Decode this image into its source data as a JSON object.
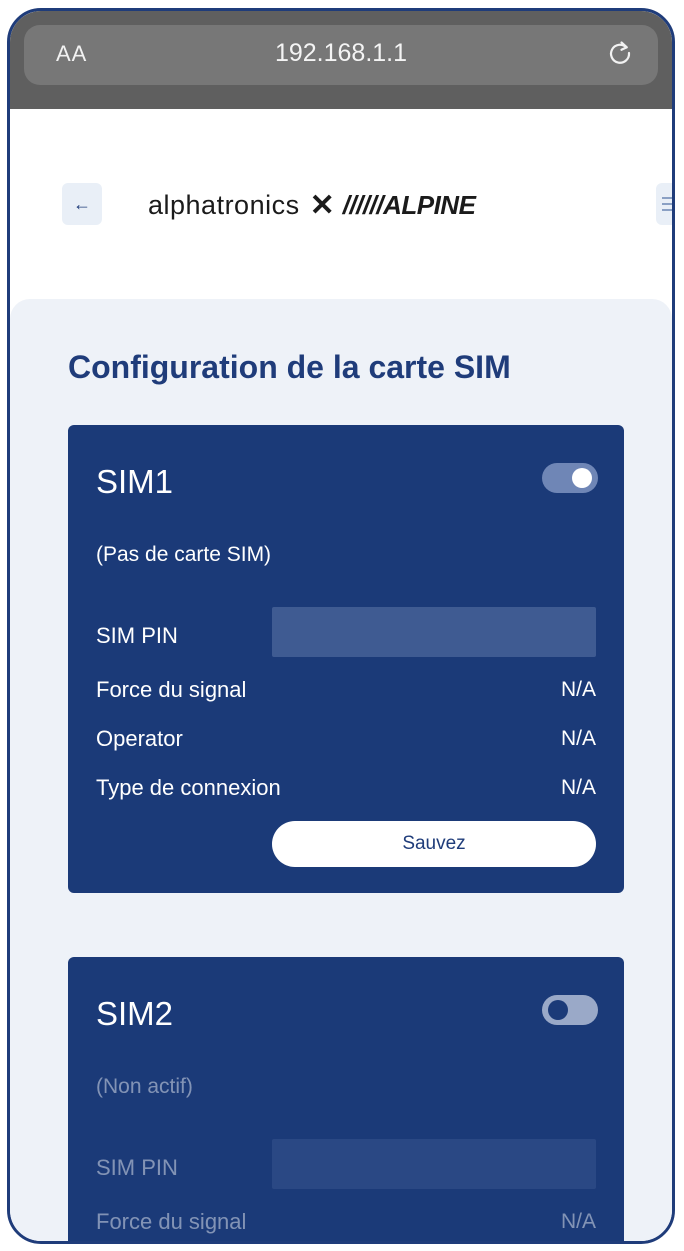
{
  "browser": {
    "text_size_label": "AA",
    "url": "192.168.1.1",
    "reload_icon": "reload-icon"
  },
  "header": {
    "back_icon": "←",
    "logo_left": "alphatronics",
    "logo_x": "✕",
    "logo_right": "//////ALPINE",
    "menu_icon": "hamburger-menu-icon"
  },
  "page": {
    "title": "Configuration de la carte SIM"
  },
  "sim1": {
    "title": "SIM1",
    "enabled": true,
    "status": "(Pas de carte SIM)",
    "pin_label": "SIM PIN",
    "pin_value": "",
    "signal_label": "Force du signal",
    "signal_value": "N/A",
    "operator_label": "Operator",
    "operator_value": "N/A",
    "connection_label": "Type de connexion",
    "connection_value": "N/A",
    "save_label": "Sauvez"
  },
  "sim2": {
    "title": "SIM2",
    "enabled": false,
    "status": "(Non actif)",
    "pin_label": "SIM PIN",
    "pin_value": "",
    "signal_label": "Force du signal",
    "signal_value": "N/A"
  },
  "colors": {
    "brand_blue": "#1f3c7a",
    "card_blue": "#1b3a78",
    "page_bg": "#eef2f8",
    "browser_bar": "#5f5f5f"
  }
}
